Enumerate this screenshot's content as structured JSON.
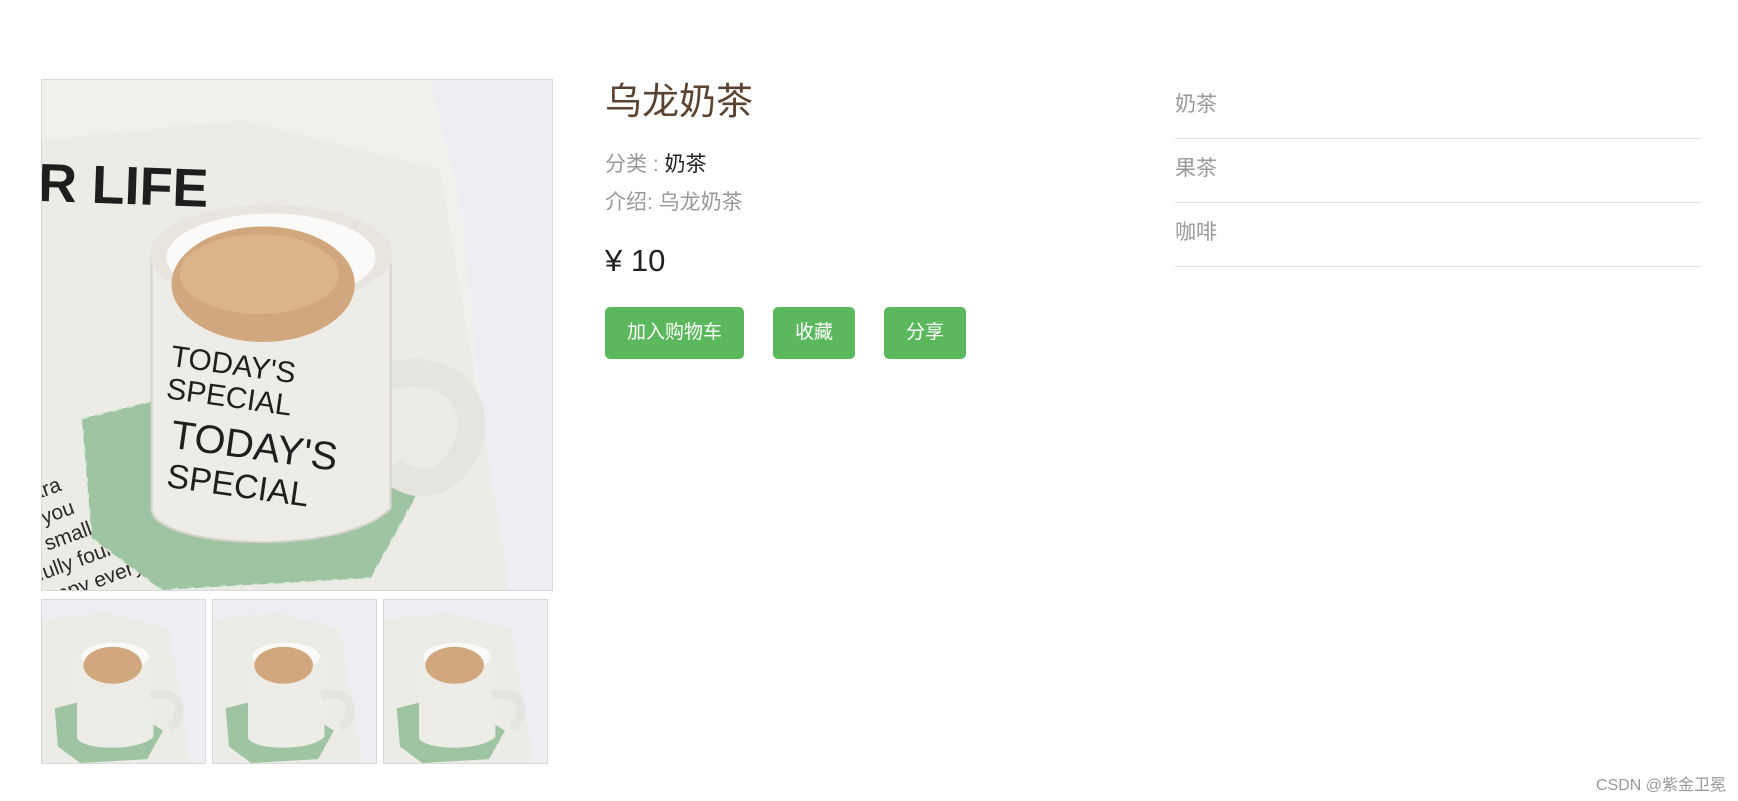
{
  "product": {
    "title": "乌龙奶茶",
    "category_label": "分类 : ",
    "category_value": "奶茶",
    "intro_label": "介绍: ",
    "intro_value": "乌龙奶茶",
    "price": "¥ 10"
  },
  "mug_print": {
    "banner": "R LIFE",
    "line1": "TODAY'S",
    "line2": "SPECIAL",
    "line3": "TODAY'S",
    "line4": "SPECIAL",
    "napkin_text": [
      "chara",
      "d, you",
      "n small",
      "fully foun",
      "appy every"
    ]
  },
  "actions": {
    "add_to_cart": "加入购物车",
    "favorite": "收藏",
    "share": "分享"
  },
  "side_menu": {
    "items": [
      {
        "label": "奶茶"
      },
      {
        "label": "果茶"
      },
      {
        "label": "咖啡"
      }
    ]
  },
  "gallery": {
    "image_subject": "cup-of-milk-tea-photo",
    "thumbnail_count": 3
  },
  "colors": {
    "button_green": "#5cb85c",
    "title_brown": "#5a4330",
    "muted_gray": "#999999"
  },
  "watermark": "CSDN @紫金卫冕"
}
